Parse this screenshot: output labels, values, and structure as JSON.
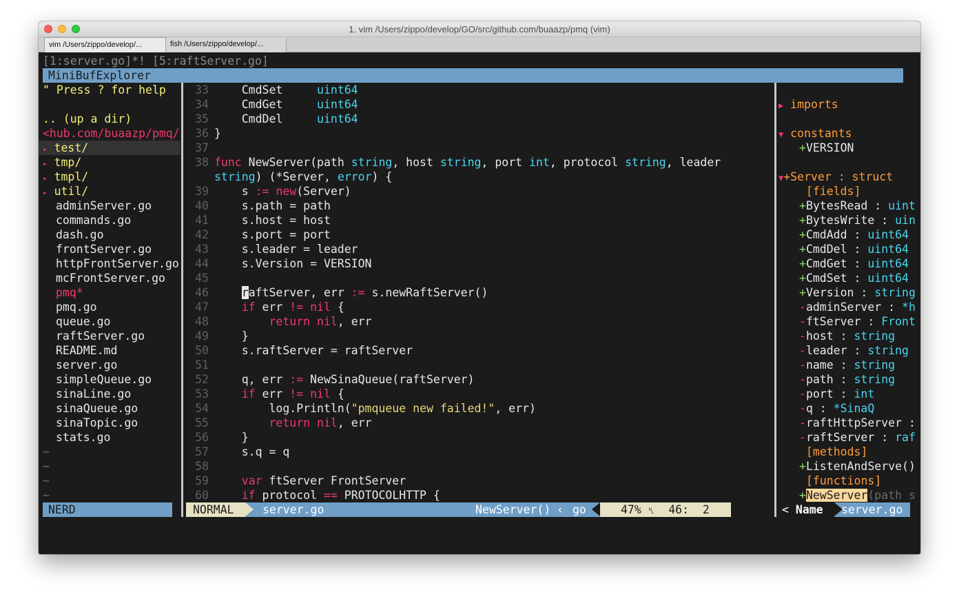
{
  "window": {
    "title": "1. vim  /Users/zippo/develop/GO/src/github.com/buaazp/pmq (vim)",
    "tabs": [
      {
        "label": "vim  /Users/zippo/develop/..."
      },
      {
        "label": "fish  /Users/zippo/develop/..."
      }
    ]
  },
  "bufbar": {
    "text": "[1:server.go]*! [5:raftServer.go]",
    "minibuf_title": "MiniBufExplorer"
  },
  "nerd": {
    "help": "\" Press ? for help",
    "up": ".. (up a dir)",
    "path": "<hub.com/buaazp/pmq/",
    "dirs": [
      "test/",
      "tmp/",
      "tmpl/",
      "util/"
    ],
    "dir_marker": "▸",
    "files": [
      "adminServer.go",
      "commands.go",
      "dash.go",
      "frontServer.go",
      "httpFrontServer.go",
      "mcFrontServer.go",
      "pmq*",
      "pmq.go",
      "queue.go",
      "raftServer.go",
      "README.md",
      "server.go",
      "simpleQueue.go",
      "sinaLine.go",
      "sinaQueue.go",
      "sinaTopic.go",
      "stats.go"
    ],
    "tilde": "~"
  },
  "editor": {
    "line_numbers": [
      "33",
      "34",
      "35",
      "36",
      "37",
      "38",
      "",
      "39",
      "40",
      "41",
      "42",
      "43",
      "44",
      "45",
      "46",
      "47",
      "48",
      "49",
      "50",
      "51",
      "52",
      "53",
      "54",
      "55",
      "56",
      "57",
      "58",
      "59",
      "60"
    ]
  },
  "tagbar": {
    "imports": "imports",
    "constants": "constants",
    "version_const": "+VERSION",
    "server_struct": "+Server : struct",
    "fields_header": "[fields]",
    "fields": [
      {
        "sign": "+",
        "name": "BytesRead",
        "type": "uint"
      },
      {
        "sign": "+",
        "name": "BytesWrite",
        "type": "uin"
      },
      {
        "sign": "+",
        "name": "CmdAdd",
        "type": "uint64"
      },
      {
        "sign": "+",
        "name": "CmdDel",
        "type": "uint64"
      },
      {
        "sign": "+",
        "name": "CmdGet",
        "type": "uint64"
      },
      {
        "sign": "+",
        "name": "CmdSet",
        "type": "uint64"
      },
      {
        "sign": "+",
        "name": "Version",
        "type": "string"
      },
      {
        "sign": "-",
        "name": "adminServer",
        "type": "*h"
      },
      {
        "sign": "-",
        "name": "ftServer",
        "type": "Front"
      },
      {
        "sign": "-",
        "name": "host",
        "type": "string"
      },
      {
        "sign": "-",
        "name": "leader",
        "type": "string"
      },
      {
        "sign": "-",
        "name": "name",
        "type": "string"
      },
      {
        "sign": "-",
        "name": "path",
        "type": "string"
      },
      {
        "sign": "-",
        "name": "port",
        "type": "int"
      },
      {
        "sign": "-",
        "name": "q",
        "type": "*SinaQ"
      },
      {
        "sign": "-",
        "name": "raftHttpServer",
        "type": ""
      },
      {
        "sign": "-",
        "name": "raftServer",
        "type": "raf"
      }
    ],
    "methods_header": "[methods]",
    "method": "+ListenAndServe()",
    "functions_header": "[functions]",
    "function_sign": "+",
    "function_name": "NewServer",
    "function_args": "(path s"
  },
  "status": {
    "nerd_label": "NERD",
    "mode": "NORMAL",
    "file": "server.go",
    "func": "NewServer()",
    "filetype": "go",
    "percent": "47%",
    "line_col": "46:  2",
    "tag_label": "Name",
    "tag_file": "server.go"
  },
  "colors": {
    "keyword": "#f0386b",
    "type": "#4ad5f0",
    "string": "#e6d879",
    "status_bar": "#6f9fc7"
  }
}
